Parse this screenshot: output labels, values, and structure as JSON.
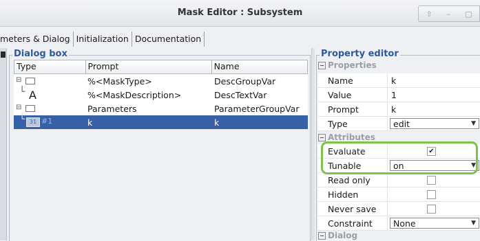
{
  "window": {
    "title": "Mask Editor : Subsystem"
  },
  "tabs": [
    {
      "label": "meters & Dialog"
    },
    {
      "label": "Initialization"
    },
    {
      "label": "Documentation"
    }
  ],
  "dialog_box": {
    "title": "Dialog box",
    "columns": [
      "Type",
      "Prompt",
      "Name"
    ],
    "rows": [
      {
        "type_icon": "group-box-icon",
        "type_text": "",
        "prompt": "%<MaskType>",
        "name": "DescGroupVar"
      },
      {
        "type_icon": "text-icon",
        "type_text": "A",
        "prompt": "%<MaskDescription>",
        "name": "DescTextVar"
      },
      {
        "type_icon": "group-box-icon",
        "type_text": "",
        "prompt": "Parameters",
        "name": "ParameterGroupVar"
      },
      {
        "type_icon": "edit-parameter-icon",
        "type_text": "#1",
        "prompt": "k",
        "name": "k",
        "selected": true
      }
    ]
  },
  "property_editor": {
    "title": "Property editor",
    "sections": {
      "properties": "Properties",
      "attributes": "Attributes",
      "dialog": "Dialog"
    },
    "properties": [
      {
        "label": "Name",
        "value": "k"
      },
      {
        "label": "Value",
        "value": "1"
      },
      {
        "label": "Prompt",
        "value": "k"
      },
      {
        "label": "Type",
        "value": "edit",
        "kind": "combo"
      }
    ],
    "attributes": [
      {
        "label": "Evaluate",
        "checked": true
      },
      {
        "label": "Tunable",
        "value": "on",
        "kind": "combo"
      },
      {
        "label": "Read only",
        "checked": false
      },
      {
        "label": "Hidden",
        "checked": false
      },
      {
        "label": "Never save",
        "checked": false
      },
      {
        "label": "Constraint",
        "value": "None",
        "kind": "combo"
      }
    ]
  },
  "colors": {
    "accent": "#3760a6",
    "highlight": "#7ec24b",
    "section_title": "#2d5a9c"
  }
}
